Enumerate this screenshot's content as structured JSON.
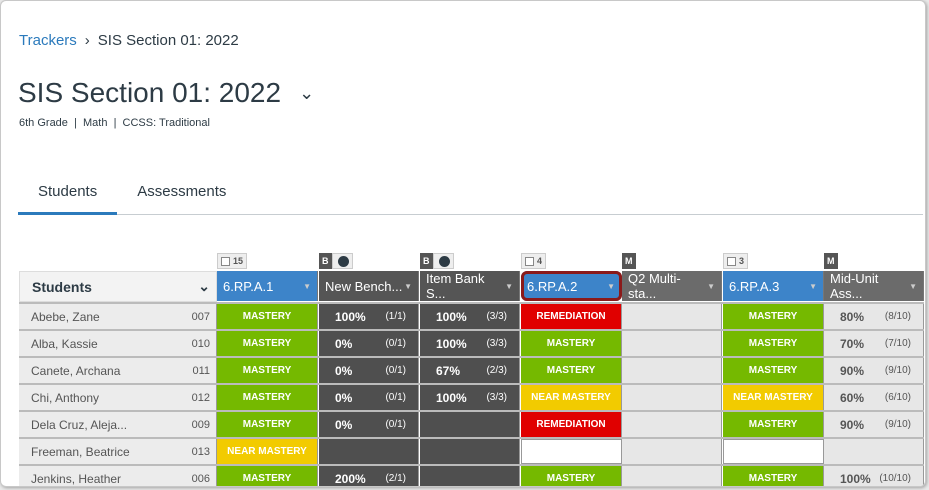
{
  "breadcrumb": {
    "root": "Trackers",
    "current": "SIS Section 01: 2022"
  },
  "title": "SIS Section 01: 2022",
  "subtitle": "6th Grade  |  Math  |  CCSS: Traditional",
  "tabs": [
    "Students",
    "Assessments"
  ],
  "students_header": "Students",
  "columns": [
    {
      "badge": "15",
      "badge_type": "count",
      "label": "6.RP.A.1",
      "style": "blue"
    },
    {
      "badge": "B",
      "badge_type": "bench",
      "label": "New Bench...",
      "style": "dark"
    },
    {
      "badge": "B",
      "badge_type": "bench",
      "label": "Item Bank S...",
      "style": "dark"
    },
    {
      "badge": "4",
      "badge_type": "count",
      "label": "6.RP.A.2",
      "style": "blue",
      "selected": true
    },
    {
      "badge": "M",
      "badge_type": "m",
      "label": "Q2 Multi-sta...",
      "style": "gray"
    },
    {
      "badge": "3",
      "badge_type": "count",
      "label": "6.RP.A.3",
      "style": "blue"
    },
    {
      "badge": "M",
      "badge_type": "m",
      "label": "Mid-Unit Ass...",
      "style": "gray"
    }
  ],
  "rows": [
    {
      "name": "Abebe, Zane",
      "id": "007",
      "cells": [
        [
          "m",
          "MASTERY"
        ],
        [
          "p",
          "100%",
          "(1/1)"
        ],
        [
          "p",
          "100%",
          "(3/3)"
        ],
        [
          "r",
          "REMEDIATION"
        ],
        [
          "e"
        ],
        [
          "m",
          "MASTERY"
        ],
        [
          "q",
          "80%",
          "(8/10)"
        ]
      ]
    },
    {
      "name": "Alba, Kassie",
      "id": "010",
      "cells": [
        [
          "m",
          "MASTERY"
        ],
        [
          "p",
          "0%",
          "(0/1)"
        ],
        [
          "p",
          "100%",
          "(3/3)"
        ],
        [
          "m",
          "MASTERY"
        ],
        [
          "e"
        ],
        [
          "m",
          "MASTERY"
        ],
        [
          "q",
          "70%",
          "(7/10)"
        ]
      ]
    },
    {
      "name": "Canete, Archana",
      "id": "011",
      "cells": [
        [
          "m",
          "MASTERY"
        ],
        [
          "p",
          "0%",
          "(0/1)"
        ],
        [
          "p",
          "67%",
          "(2/3)"
        ],
        [
          "m",
          "MASTERY"
        ],
        [
          "e"
        ],
        [
          "m",
          "MASTERY"
        ],
        [
          "q",
          "90%",
          "(9/10)"
        ]
      ]
    },
    {
      "name": "Chi, Anthony",
      "id": "012",
      "cells": [
        [
          "m",
          "MASTERY"
        ],
        [
          "p",
          "0%",
          "(0/1)"
        ],
        [
          "p",
          "100%",
          "(3/3)"
        ],
        [
          "n",
          "NEAR MASTERY"
        ],
        [
          "e"
        ],
        [
          "n",
          "NEAR MASTERY"
        ],
        [
          "q",
          "60%",
          "(6/10)"
        ]
      ]
    },
    {
      "name": "Dela Cruz, Aleja...",
      "id": "009",
      "cells": [
        [
          "m",
          "MASTERY"
        ],
        [
          "p",
          "0%",
          "(0/1)"
        ],
        [
          "d"
        ],
        [
          "r",
          "REMEDIATION"
        ],
        [
          "e"
        ],
        [
          "m",
          "MASTERY"
        ],
        [
          "q",
          "90%",
          "(9/10)"
        ]
      ]
    },
    {
      "name": "Freeman, Beatrice",
      "id": "013",
      "cells": [
        [
          "n",
          "NEAR MASTERY"
        ],
        [
          "d"
        ],
        [
          "d"
        ],
        [
          "w"
        ],
        [
          "e"
        ],
        [
          "w"
        ],
        [
          "e"
        ]
      ]
    },
    {
      "name": "Jenkins, Heather",
      "id": "006",
      "cells": [
        [
          "m",
          "MASTERY"
        ],
        [
          "p",
          "200%",
          "(2/1)"
        ],
        [
          "d"
        ],
        [
          "m",
          "MASTERY"
        ],
        [
          "e"
        ],
        [
          "m",
          "MASTERY"
        ],
        [
          "q",
          "100%",
          "(10/10)"
        ]
      ]
    }
  ]
}
